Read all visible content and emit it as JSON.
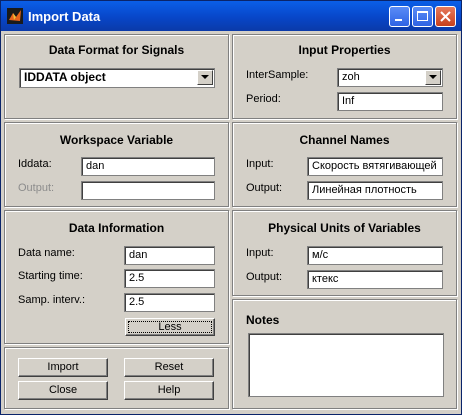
{
  "window": {
    "title": "Import Data"
  },
  "data_format": {
    "title": "Data Format for Signals",
    "selected": "IDDATA object"
  },
  "input_properties": {
    "title": "Input Properties",
    "intersample_label": "InterSample:",
    "intersample_value": "zoh",
    "period_label": "Period:",
    "period_value": "Inf"
  },
  "workspace_variable": {
    "title": "Workspace Variable",
    "iddata_label": "Iddata:",
    "iddata_value": "dan",
    "output_label": "Output:",
    "output_value": ""
  },
  "channel_names": {
    "title": "Channel Names",
    "input_label": "Input:",
    "input_value": "Скорость вятягивающей",
    "output_label": "Output:",
    "output_value": "Линейная плотность"
  },
  "data_information": {
    "title": "Data Information",
    "name_label": "Data name:",
    "name_value": "dan",
    "start_label": "Starting time:",
    "start_value": "2.5",
    "interv_label": "Samp. interv.:",
    "interv_value": "2.5",
    "less_button": "Less"
  },
  "physical_units": {
    "title": "Physical Units of Variables",
    "input_label": "Input:",
    "input_value": "м/с",
    "output_label": "Output:",
    "output_value": "ктекс"
  },
  "notes": {
    "title": "Notes",
    "value": ""
  },
  "actions": {
    "import": "Import",
    "reset": "Reset",
    "close": "Close",
    "help": "Help"
  }
}
